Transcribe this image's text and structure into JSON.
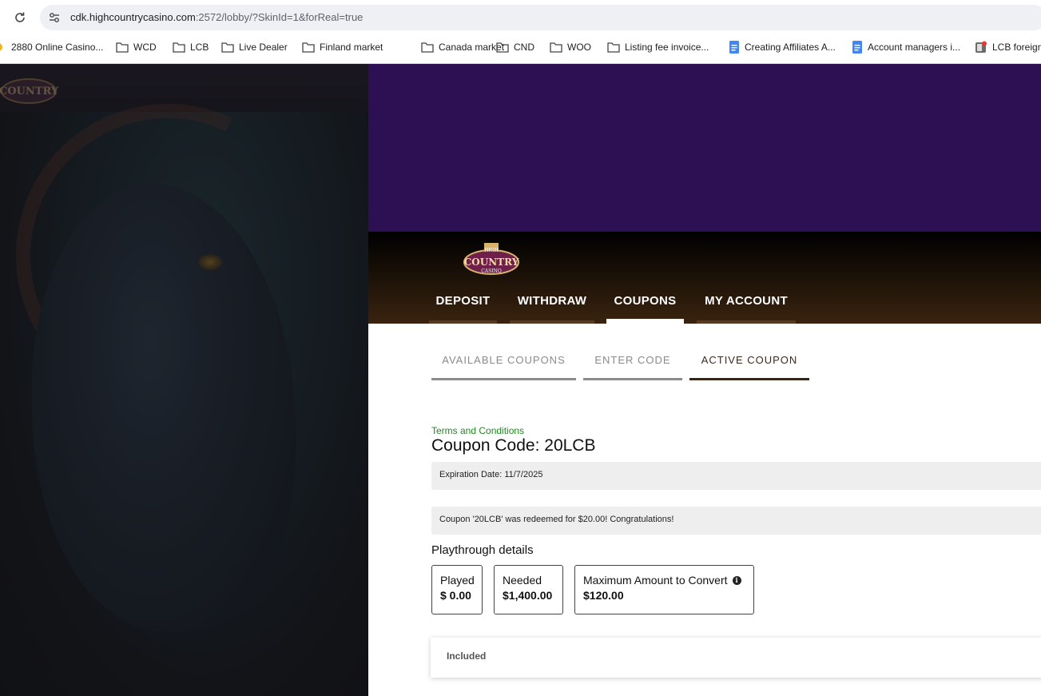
{
  "browser": {
    "url_host": "cdk.highcountrycasino.com",
    "url_rest": ":2572/lobby/?SkinId=1&forReal=true",
    "bookmarks": [
      {
        "label": "2880 Online Casino...",
        "icon": "bookmark-favicon"
      },
      {
        "label": "WCD",
        "icon": "folder-icon"
      },
      {
        "label": "LCB",
        "icon": "folder-icon"
      },
      {
        "label": "Live Dealer",
        "icon": "folder-icon"
      },
      {
        "label": "Finland market",
        "icon": "folder-icon"
      },
      {
        "label": "Canada market",
        "icon": "folder-icon"
      },
      {
        "label": "CND",
        "icon": "folder-icon"
      },
      {
        "label": "WOO",
        "icon": "folder-icon"
      },
      {
        "label": "Listing fee invoice...",
        "icon": "folder-icon"
      },
      {
        "label": "Creating Affiliates A...",
        "icon": "google-docs-icon"
      },
      {
        "label": "Account managers i...",
        "icon": "google-docs-icon"
      },
      {
        "label": "LCB foreign",
        "icon": "app-favicon"
      }
    ]
  },
  "brand": {
    "logo_top": "HIGH",
    "logo_main": "COUNTRY",
    "logo_bottom": "CASINO"
  },
  "nav": {
    "tabs": [
      {
        "label": "DEPOSIT",
        "active": false
      },
      {
        "label": "WITHDRAW",
        "active": false
      },
      {
        "label": "COUPONS",
        "active": true
      },
      {
        "label": "MY ACCOUNT",
        "active": false
      }
    ]
  },
  "coupons": {
    "subtabs": [
      {
        "label": "AVAILABLE COUPONS",
        "active": false
      },
      {
        "label": "ENTER CODE",
        "active": false
      },
      {
        "label": "ACTIVE COUPON",
        "active": true
      }
    ],
    "terms_link": "Terms and Conditions",
    "coupon_code": "Coupon Code: 20LCB",
    "expiration": "Expiration Date: 11/7/2025",
    "redeemed_message": "Coupon '20LCB' was redeemed for $20.00! Congratulations!",
    "playthrough_title": "Playthrough details",
    "played_label": "Played",
    "played_value": "$ 0.00",
    "needed_label": "Needed",
    "needed_value": "$1,400.00",
    "max_label": "Maximum Amount to Convert",
    "max_value": "$120.00",
    "included_label": "Included"
  },
  "colors": {
    "header_purple": "#2d0f54",
    "terms_green": "#1f8a1f",
    "active_underline": "#3b2412"
  }
}
